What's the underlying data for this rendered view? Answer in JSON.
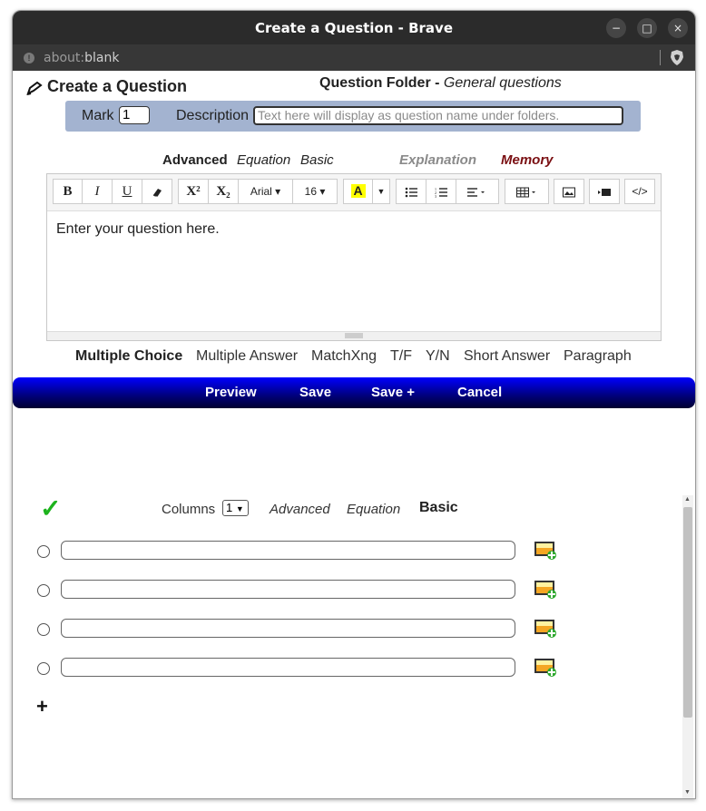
{
  "window": {
    "title": "Create a Question - Brave",
    "minimize": "−",
    "maximize": "□",
    "close": "×"
  },
  "address": {
    "scheme": "about:",
    "path": "blank"
  },
  "header": {
    "title": "Create a Question",
    "folder_label": "Question Folder -",
    "folder_name": "General questions"
  },
  "mark": {
    "label": "Mark",
    "value": "1"
  },
  "description": {
    "label": "Description",
    "placeholder": "Text here will display as question name under folders."
  },
  "editor_modes": {
    "advanced": "Advanced",
    "equation": "Equation",
    "basic": "Basic",
    "explanation": "Explanation",
    "memory": "Memory"
  },
  "toolbar": {
    "bold": "B",
    "italic": "I",
    "underline": "U",
    "superscript": "X²",
    "subscript": "X₂",
    "font_family": "Arial",
    "font_size": "16",
    "text_color": "A",
    "code": "</>"
  },
  "editor": {
    "placeholder": "Enter your question here."
  },
  "question_types": [
    "Multiple Choice",
    "Multiple Answer",
    "MatchXng",
    "T/F",
    "Y/N",
    "Short Answer",
    "Paragraph"
  ],
  "actions": {
    "preview": "Preview",
    "save": "Save",
    "save_plus": "Save +",
    "cancel": "Cancel"
  },
  "answers": {
    "check": "✓",
    "columns_label": "Columns",
    "columns_value": "1",
    "advanced": "Advanced",
    "equation": "Equation",
    "basic": "Basic",
    "add": "+"
  },
  "colors": {
    "action_bar": "#0000ff",
    "memory": "#7a0f12",
    "mark_bar": "#a3b3d0",
    "check": "#1db31d"
  }
}
